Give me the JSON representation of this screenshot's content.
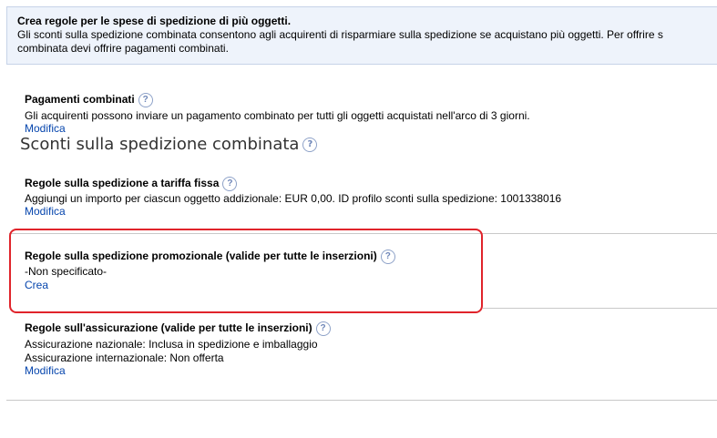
{
  "banner": {
    "title": "Crea regole per le spese di spedizione di più oggetti.",
    "description": "Gli sconti sulla spedizione combinata consentono agli acquirenti di risparmiare sulla spedizione se acquistano più oggetti. Per offrire s\ncombinata devi offrire pagamenti combinati."
  },
  "combined_payments": {
    "title": "Pagamenti combinati",
    "text": "Gli acquirenti possono inviare un pagamento combinato per tutti gli oggetti acquistati nell'arco di 3 giorni.",
    "link": "Modifica"
  },
  "combined_shipping_heading": "Sconti sulla spedizione combinata",
  "flat_rate": {
    "title": "Regole sulla spedizione a tariffa fissa",
    "text": "Aggiungi un importo per ciascun oggetto addizionale: EUR 0,00. ID profilo sconti sulla spedizione: 1001338016",
    "link": "Modifica"
  },
  "promotional": {
    "title": "Regole sulla spedizione promozionale (valide per tutte le inserzioni)",
    "text": "-Non specificato-",
    "link": "Crea"
  },
  "insurance": {
    "title": "Regole sull'assicurazione (valide per tutte le inserzioni)",
    "line1": "Assicurazione nazionale: Inclusa in spedizione e imballaggio",
    "line2": "Assicurazione internazionale: Non offerta",
    "link": "Modifica"
  },
  "help_glyph": "?",
  "colors": {
    "link": "#0645ad",
    "highlight_box": "#e0242b",
    "banner_bg": "#eef3fb"
  }
}
